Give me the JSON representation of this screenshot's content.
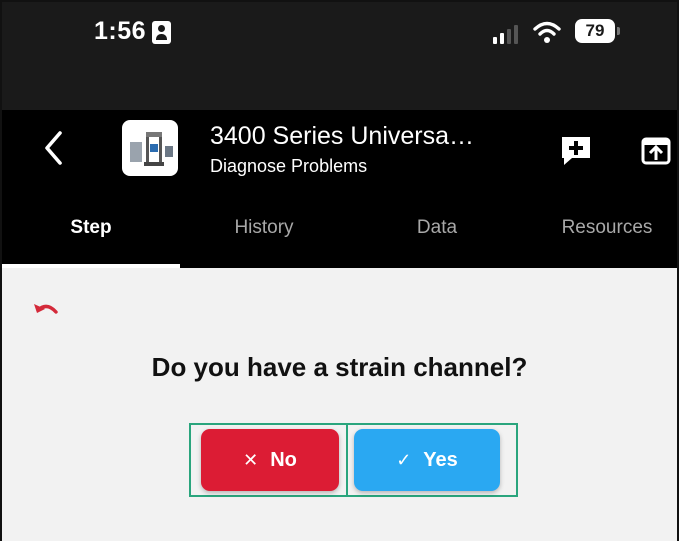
{
  "status_bar": {
    "time": "1:56",
    "battery": "79",
    "icons": [
      "contact-card-icon",
      "cellular-signal-icon",
      "wifi-icon",
      "battery-icon"
    ]
  },
  "app_bar": {
    "title": "3400 Series Universa…",
    "subtitle": "Diagnose Problems",
    "icons": [
      "back-arrow-icon",
      "equipment-thumbnail",
      "add-note-icon",
      "share-icon"
    ]
  },
  "tabs": [
    {
      "label": "Step",
      "active": true
    },
    {
      "label": "History",
      "active": false
    },
    {
      "label": "Data",
      "active": false
    },
    {
      "label": "Resources",
      "active": false
    }
  ],
  "step": {
    "question": "Do you have a strain channel?",
    "no_mark": "✕",
    "no_label": "No",
    "yes_mark": "✓",
    "yes_label": "Yes"
  },
  "colors": {
    "no_button": "#dc1c34",
    "yes_button": "#2aa8f2",
    "highlight": "#2aa57d",
    "undo_icon": "#d42a3a"
  }
}
